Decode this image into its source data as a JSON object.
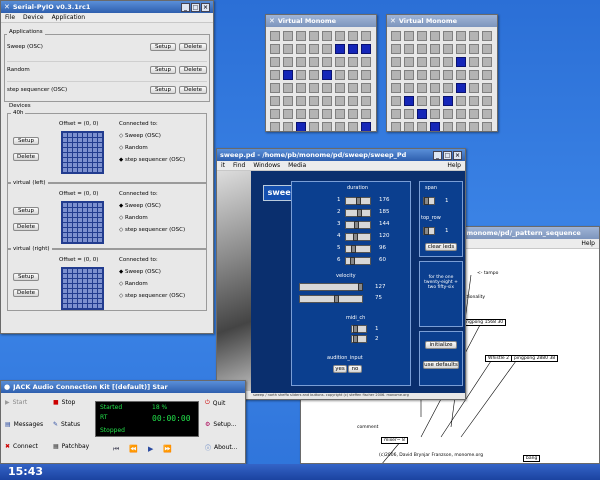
{
  "serialpyio": {
    "title": "Serial-PyIO v0.3.1rc1",
    "menu": [
      "File",
      "Device",
      "Application"
    ],
    "applications_label": "Applications",
    "apps": [
      {
        "name": "Sweep (OSC)",
        "setup": "Setup",
        "delete": "Delete"
      },
      {
        "name": "Random",
        "setup": "Setup",
        "delete": "Delete"
      },
      {
        "name": "step sequencer (OSC)",
        "setup": "Setup",
        "delete": "Delete"
      }
    ],
    "devices_label": "Devices",
    "devices": [
      {
        "name": "40h",
        "offset": "Offset = (0, 0)",
        "connected": "Connected to:",
        "setup": "Setup",
        "delete": "Delete",
        "options": [
          "Sweep (OSC)",
          "Random",
          "step sequencer (OSC)"
        ],
        "selected": 2
      },
      {
        "name": "virtual (left)",
        "offset": "Offset = (0, 0)",
        "connected": "Connected to:",
        "setup": "Setup",
        "delete": "Delete",
        "options": [
          "Sweep (OSC)",
          "Random",
          "step sequencer (OSC)"
        ],
        "selected": 0
      },
      {
        "name": "virtual (right)",
        "offset": "Offset = (0, 0)",
        "connected": "Connected to:",
        "setup": "Setup",
        "delete": "Delete",
        "options": [
          "Sweep (OSC)",
          "Random",
          "step sequencer (OSC)"
        ],
        "selected": 0
      }
    ]
  },
  "monome1": {
    "title": "Virtual Monome",
    "grid": [
      [
        0,
        0,
        0,
        0,
        0,
        0,
        0,
        0
      ],
      [
        0,
        0,
        0,
        0,
        0,
        1,
        1,
        1
      ],
      [
        0,
        0,
        0,
        0,
        0,
        0,
        0,
        0
      ],
      [
        0,
        1,
        0,
        0,
        1,
        0,
        0,
        0
      ],
      [
        0,
        0,
        0,
        0,
        0,
        0,
        0,
        0
      ],
      [
        0,
        0,
        0,
        0,
        0,
        0,
        0,
        0
      ],
      [
        0,
        0,
        0,
        0,
        0,
        0,
        0,
        0
      ],
      [
        0,
        0,
        1,
        0,
        0,
        0,
        0,
        1
      ]
    ]
  },
  "monome2": {
    "title": "Virtual Monome",
    "grid": [
      [
        0,
        0,
        0,
        0,
        0,
        0,
        0,
        0
      ],
      [
        0,
        0,
        0,
        0,
        0,
        0,
        0,
        0
      ],
      [
        0,
        0,
        0,
        0,
        0,
        1,
        0,
        0
      ],
      [
        0,
        0,
        0,
        0,
        0,
        0,
        0,
        0
      ],
      [
        0,
        0,
        0,
        0,
        0,
        1,
        0,
        0
      ],
      [
        0,
        1,
        0,
        0,
        1,
        0,
        0,
        0
      ],
      [
        0,
        0,
        1,
        0,
        0,
        0,
        0,
        0
      ],
      [
        0,
        0,
        0,
        1,
        0,
        0,
        0,
        0
      ]
    ]
  },
  "sweep": {
    "title": "sweep.pd - /home/pb/monome/pd/sweep/sweep_Pd",
    "menu": [
      "it",
      "Find",
      "Windows",
      "Media"
    ],
    "help": "Help",
    "logo": "sweep",
    "duration_label": "duration",
    "sliders": [
      {
        "n": "1",
        "v": "176",
        "pos": 0.55
      },
      {
        "n": "2",
        "v": "185",
        "pos": 0.6
      },
      {
        "n": "3",
        "v": "144",
        "pos": 0.45
      },
      {
        "n": "4",
        "v": "120",
        "pos": 0.4
      },
      {
        "n": "5",
        "v": "96",
        "pos": 0.3
      },
      {
        "n": "6",
        "v": "60",
        "pos": 0.2
      }
    ],
    "velocity_label": "velocity",
    "velocity_values": [
      "127",
      "75"
    ],
    "midi_label": "midi_ch",
    "midi_values": [
      "1",
      "2"
    ],
    "audition_label": "audition_input",
    "yes": "yes",
    "no": "no",
    "span_label": "span",
    "span_value": "1",
    "toprow_label": "top_row",
    "toprow_value": "1",
    "clear": "clear leds",
    "info": "for the one twenty-eight + two fifty-six",
    "initialize": "initialize",
    "defaults": "use defaults",
    "footer": "sweep / north sheffo sliders and buttons. copyright (c) steffen fischer 2006. monome.org"
  },
  "pattern": {
    "title": "/monome/pd/_pattern_sequence",
    "help": "Help",
    "texts": [
      "<- tampo",
      "40h functionality",
      "pingpong 1568 30",
      "Whistle 2",
      "pingpong 2880 38",
      "mixer~ 8",
      "(c)2006, David Brynjar Franzson, monome.org",
      "bang",
      "pd license",
      "comment",
      "dac~"
    ]
  },
  "jack": {
    "title": "JACK Audio Connection Kit [(default)] Star",
    "start": "Start",
    "stop": "Stop",
    "quit": "Quit",
    "messages": "Messages",
    "status": "Status",
    "setup": "Setup...",
    "connect": "Connect",
    "patchbay": "Patchbay",
    "about": "About...",
    "started": "Started",
    "percent": "18 %",
    "rt": "RT",
    "time": "00:00:00",
    "stopped": "Stopped"
  },
  "clock": "15:43",
  "accent": "#0b3f8f"
}
